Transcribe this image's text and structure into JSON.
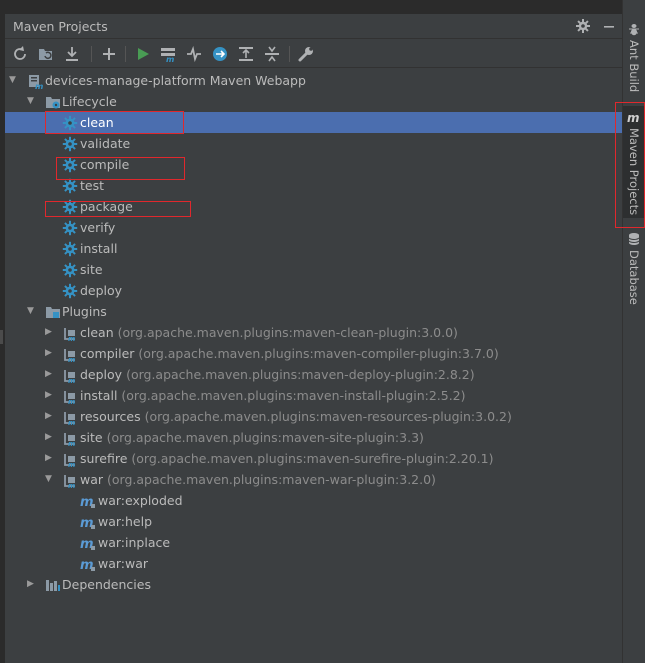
{
  "panel": {
    "title": "Maven Projects"
  },
  "toolbar": {
    "buttons": [
      {
        "name": "reimport-icon"
      },
      {
        "name": "generate-sources-icon"
      },
      {
        "name": "download-icon"
      },
      {
        "name": "add-icon"
      },
      {
        "name": "run-icon"
      },
      {
        "name": "execute-goal-icon"
      },
      {
        "name": "toggle-offline-icon"
      },
      {
        "name": "skip-tests-icon"
      },
      {
        "name": "show-dependencies-icon"
      },
      {
        "name": "collapse-all-icon"
      },
      {
        "name": "settings-wrench-icon"
      }
    ]
  },
  "tree": {
    "project": "devices-manage-platform Maven Webapp",
    "lifecycle": {
      "label": "Lifecycle",
      "phases": [
        "clean",
        "validate",
        "compile",
        "test",
        "package",
        "verify",
        "install",
        "site",
        "deploy"
      ]
    },
    "plugins": {
      "label": "Plugins",
      "items": [
        {
          "name": "clean",
          "detail": "(org.apache.maven.plugins:maven-clean-plugin:3.0.0)"
        },
        {
          "name": "compiler",
          "detail": "(org.apache.maven.plugins:maven-compiler-plugin:3.7.0)"
        },
        {
          "name": "deploy",
          "detail": "(org.apache.maven.plugins:maven-deploy-plugin:2.8.2)"
        },
        {
          "name": "install",
          "detail": "(org.apache.maven.plugins:maven-install-plugin:2.5.2)"
        },
        {
          "name": "resources",
          "detail": "(org.apache.maven.plugins:maven-resources-plugin:3.0.2)"
        },
        {
          "name": "site",
          "detail": "(org.apache.maven.plugins:maven-site-plugin:3.3)"
        },
        {
          "name": "surefire",
          "detail": "(org.apache.maven.plugins:maven-surefire-plugin:2.20.1)"
        },
        {
          "name": "war",
          "detail": "(org.apache.maven.plugins:maven-war-plugin:3.2.0)"
        }
      ],
      "war_goals": [
        "war:exploded",
        "war:help",
        "war:inplace",
        "war:war"
      ]
    },
    "dependencies": "Dependencies"
  },
  "sidebar": {
    "tabs": [
      "Ant Build",
      "Maven Projects",
      "Database"
    ],
    "active": "Maven Projects"
  },
  "colors": {
    "background": "#3c3f41",
    "selection": "#4b6eaf",
    "gear": "#3592c4",
    "highlight_box": "#e0282d"
  }
}
